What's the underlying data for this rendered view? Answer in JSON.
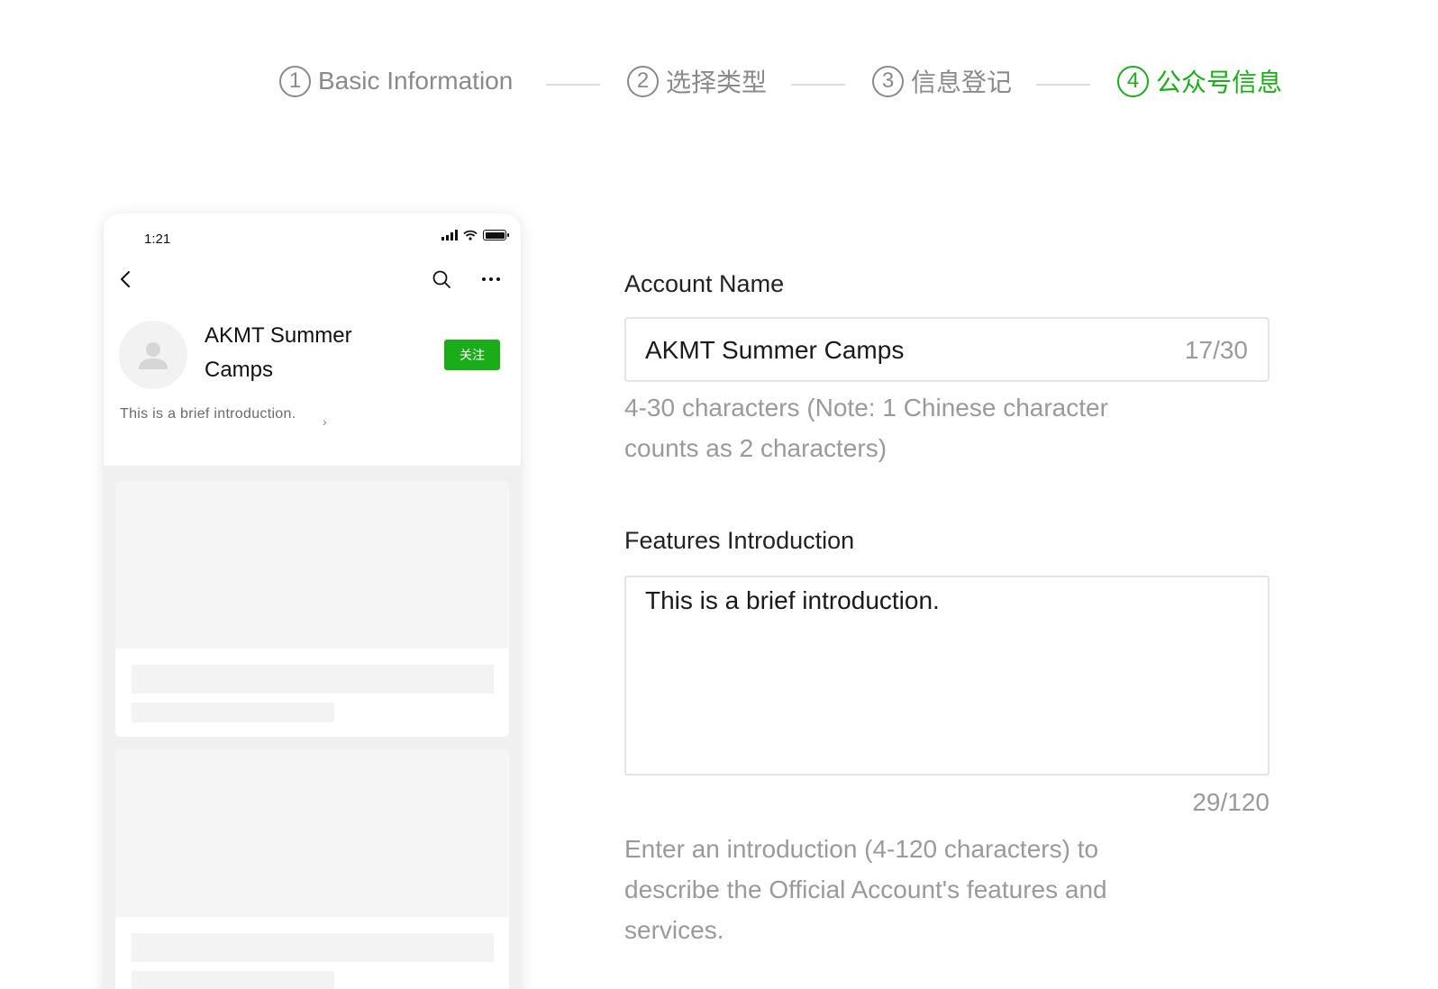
{
  "stepper": {
    "steps": [
      {
        "num": "1",
        "label": "Basic Information"
      },
      {
        "num": "2",
        "label": "选择类型"
      },
      {
        "num": "3",
        "label": "信息登记"
      },
      {
        "num": "4",
        "label": "公众号信息"
      }
    ],
    "active_step": 4
  },
  "phone": {
    "time": "1:21",
    "account_name": "AKMT Summer Camps",
    "follow_label": "关注",
    "intro": "This is a brief introduction.",
    "intro_chevron": "›",
    "icons": [
      "back-icon",
      "search-icon",
      "more-icon",
      "signal-icon",
      "wifi-icon",
      "battery-icon",
      "avatar-placeholder-icon"
    ]
  },
  "form": {
    "account_name": {
      "label": "Account Name",
      "value": "AKMT Summer Camps",
      "count": "17/30",
      "hint": "4-30 characters (Note: 1 Chinese character counts as 2 characters)"
    },
    "features": {
      "label": "Features Introduction",
      "value": "This is a brief introduction.",
      "count": "29/120",
      "hint": "Enter an introduction (4-120 characters) to describe the Official Account's features and services."
    }
  },
  "colors": {
    "accent_green": "#1aad19",
    "muted_text": "#9a9a9a",
    "border": "#e4e4e4"
  }
}
